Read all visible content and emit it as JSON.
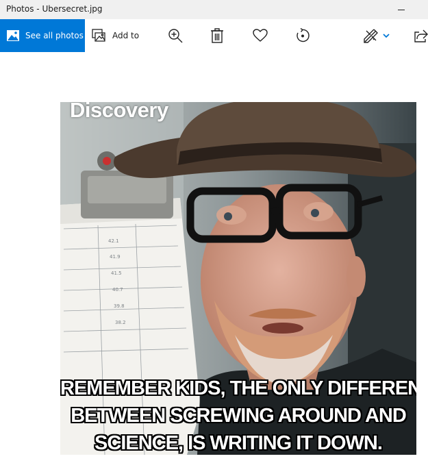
{
  "window": {
    "title": "Photos - Ubersecret.jpg"
  },
  "toolbar": {
    "see_all_label": "See all photos",
    "add_to_label": "Add to",
    "accent_color": "#0078d7"
  },
  "icons": {
    "see_all": "photos-gallery-icon",
    "add_to": "add-to-album-icon",
    "zoom": "zoom-in-icon",
    "delete": "trash-icon",
    "favorite": "heart-icon",
    "rotate": "rotate-icon",
    "edit": "edit-pencil-icon",
    "edit_dropdown": "chevron-down-icon",
    "share": "share-icon"
  },
  "photo": {
    "logo": "Discovery",
    "caption_lines": [
      "REMEMBER KIDS, THE ONLY DIFFERENCE",
      "BETWEEN SCREWING AROUND AND",
      "SCIENCE, IS WRITING IT DOWN."
    ]
  }
}
